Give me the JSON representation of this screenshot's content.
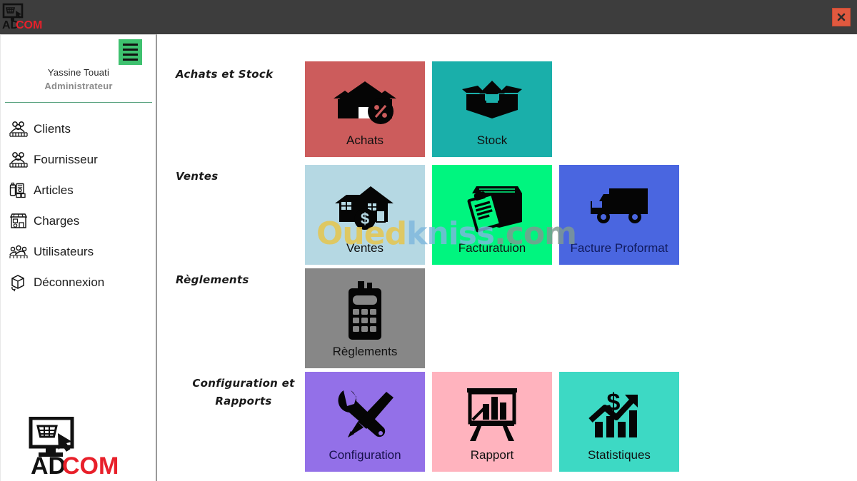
{
  "window": {
    "logo_text_dark": "AD",
    "logo_text_red": "COM",
    "close_label": "×",
    "close_icon": "close-icon"
  },
  "sidebar": {
    "menu_toggle_icon": "hamburger-menu-icon",
    "user": {
      "name": "Yassine Touati",
      "role": "Administrateur"
    },
    "items": [
      {
        "label": "Clients",
        "icon": "clients-group-icon"
      },
      {
        "label": "Fournisseur",
        "icon": "suppliers-group-icon"
      },
      {
        "label": "Articles",
        "icon": "products-jars-icon"
      },
      {
        "label": "Charges",
        "icon": "storefront-icon"
      },
      {
        "label": "Utilisateurs",
        "icon": "users-icon"
      },
      {
        "label": "Déconnexion",
        "icon": "logout-box-icon"
      }
    ],
    "brand": {
      "text_dark": "AD",
      "text_red": "COM",
      "icon": "monitor-cart-logo-icon"
    }
  },
  "main": {
    "sections": [
      {
        "label": "Achats et Stock"
      },
      {
        "label": "Ventes"
      },
      {
        "label": "Règlements"
      },
      {
        "label": "Configuration et Rapports"
      }
    ],
    "tiles": [
      {
        "label": "Achats",
        "icon": "shop-discount-icon",
        "bg": "#cc5c5c",
        "fg": "#111111"
      },
      {
        "label": "Stock",
        "icon": "open-box-icon",
        "bg": "#1aafaa",
        "fg": "#111111"
      },
      {
        "label": "Ventes",
        "icon": "house-dollar-icon",
        "bg": "#b5d8e3",
        "fg": "#111111"
      },
      {
        "label": "Facturatuion",
        "icon": "clipboard-box-icon",
        "bg": "#00f57f",
        "fg": "#111111"
      },
      {
        "label": "Facture Proformat",
        "icon": "delivery-truck-icon",
        "bg": "#4a66e0",
        "fg": "#101a5c"
      },
      {
        "label": "Règlements",
        "icon": "pos-terminal-icon",
        "bg": "#878787",
        "fg": "#111111"
      },
      {
        "label": "Configuration",
        "icon": "wrench-screwdriver-icon",
        "bg": "#9370e8",
        "fg": "#16104a"
      },
      {
        "label": "Rapport",
        "icon": "chart-easel-icon",
        "bg": "#ffb3be",
        "fg": "#111111"
      },
      {
        "label": "Statistiques",
        "icon": "growth-chart-dollar-icon",
        "bg": "#3dd9c4",
        "fg": "#111111"
      }
    ]
  },
  "watermark": {
    "part1": "Oued",
    "part2": "kniss",
    "part3": ".com"
  },
  "colors": {
    "titlebar": "#3d3d3d",
    "close_button": "#e0593f",
    "burger_green": "#3ec16f",
    "brand_red": "#e8202a"
  }
}
